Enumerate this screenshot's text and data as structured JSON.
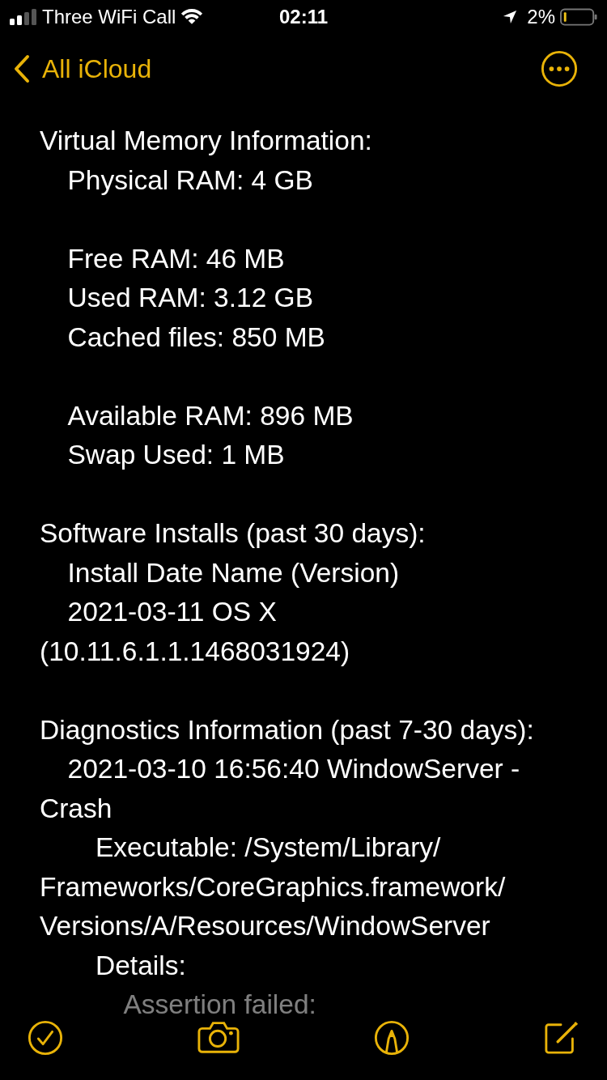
{
  "status_bar": {
    "carrier": "Three WiFi Call",
    "time": "02:11",
    "battery": "2%"
  },
  "nav": {
    "back": "All iCloud"
  },
  "note": {
    "sections": [
      {
        "title": "Virtual Memory Information:",
        "groups": [
          [
            {
              "text": "Physical RAM: 4 GB"
            }
          ],
          [
            {
              "text": "Free RAM: 46 MB"
            },
            {
              "text": "Used RAM: 3.12 GB"
            },
            {
              "text": "Cached files: 850 MB"
            }
          ],
          [
            {
              "text": "Available RAM: 896 MB"
            },
            {
              "text": "Swap Used: 1 MB"
            }
          ]
        ]
      },
      {
        "title": "Software Installs (past 30 days):",
        "groups": [
          [
            {
              "text": "Install Date Name (Version)"
            },
            {
              "text": "2021-03-11 OS X (10.11.6.1.1.1468031924)"
            }
          ]
        ]
      },
      {
        "title": "Diagnostics Information (past 7-30 days):",
        "groups": [
          [
            {
              "text": "2021-03-10 16:56:40 WindowServer - Crash",
              "children": [
                {
                  "text": "Executable: /System/Library/Frameworks/CoreGraphics.framework/Versions/A/Resources/WindowServer"
                },
                {
                  "text": "Details:",
                  "children": [
                    {
                      "text": "Assertion failed:"
                    }
                  ]
                }
              ]
            }
          ]
        ]
      }
    ]
  }
}
